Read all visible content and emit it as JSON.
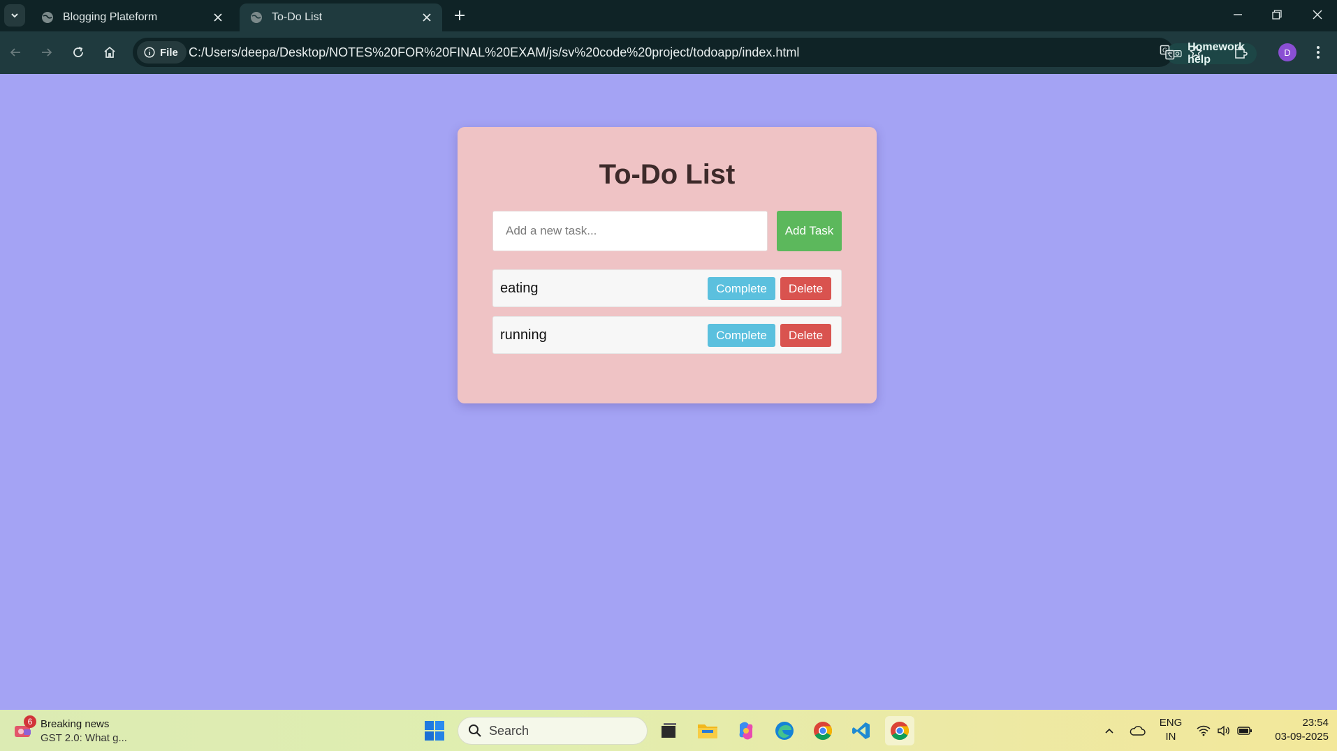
{
  "browser": {
    "tabs": [
      {
        "title": "Blogging Plateform",
        "active": false
      },
      {
        "title": "To-Do List",
        "active": true
      }
    ],
    "site_chip": "File",
    "url": "C:/Users/deepa/Desktop/NOTES%20FOR%20FINAL%20EXAM/js/sv%20code%20project/todoapp/index.html",
    "homework_help": "Homework help",
    "profile_initial": "D"
  },
  "page": {
    "title": "To-Do List",
    "input_placeholder": "Add a new task...",
    "add_button": "Add Task",
    "tasks": [
      {
        "text": "eating",
        "complete_label": "Complete",
        "delete_label": "Delete"
      },
      {
        "text": "running",
        "complete_label": "Complete",
        "delete_label": "Delete"
      }
    ]
  },
  "taskbar": {
    "news_badge": "6",
    "news_title": "Breaking news",
    "news_subtitle": "GST 2.0: What g...",
    "search_label": "Search",
    "lang_line1": "ENG",
    "lang_line2": "IN",
    "time": "23:54",
    "date": "03-09-2025"
  },
  "colors": {
    "page_background": "#a4a3f4",
    "card_background": "#efc3c5",
    "add_button": "#5cb85c",
    "complete_button": "#5bc0de",
    "delete_button": "#d9534f"
  }
}
